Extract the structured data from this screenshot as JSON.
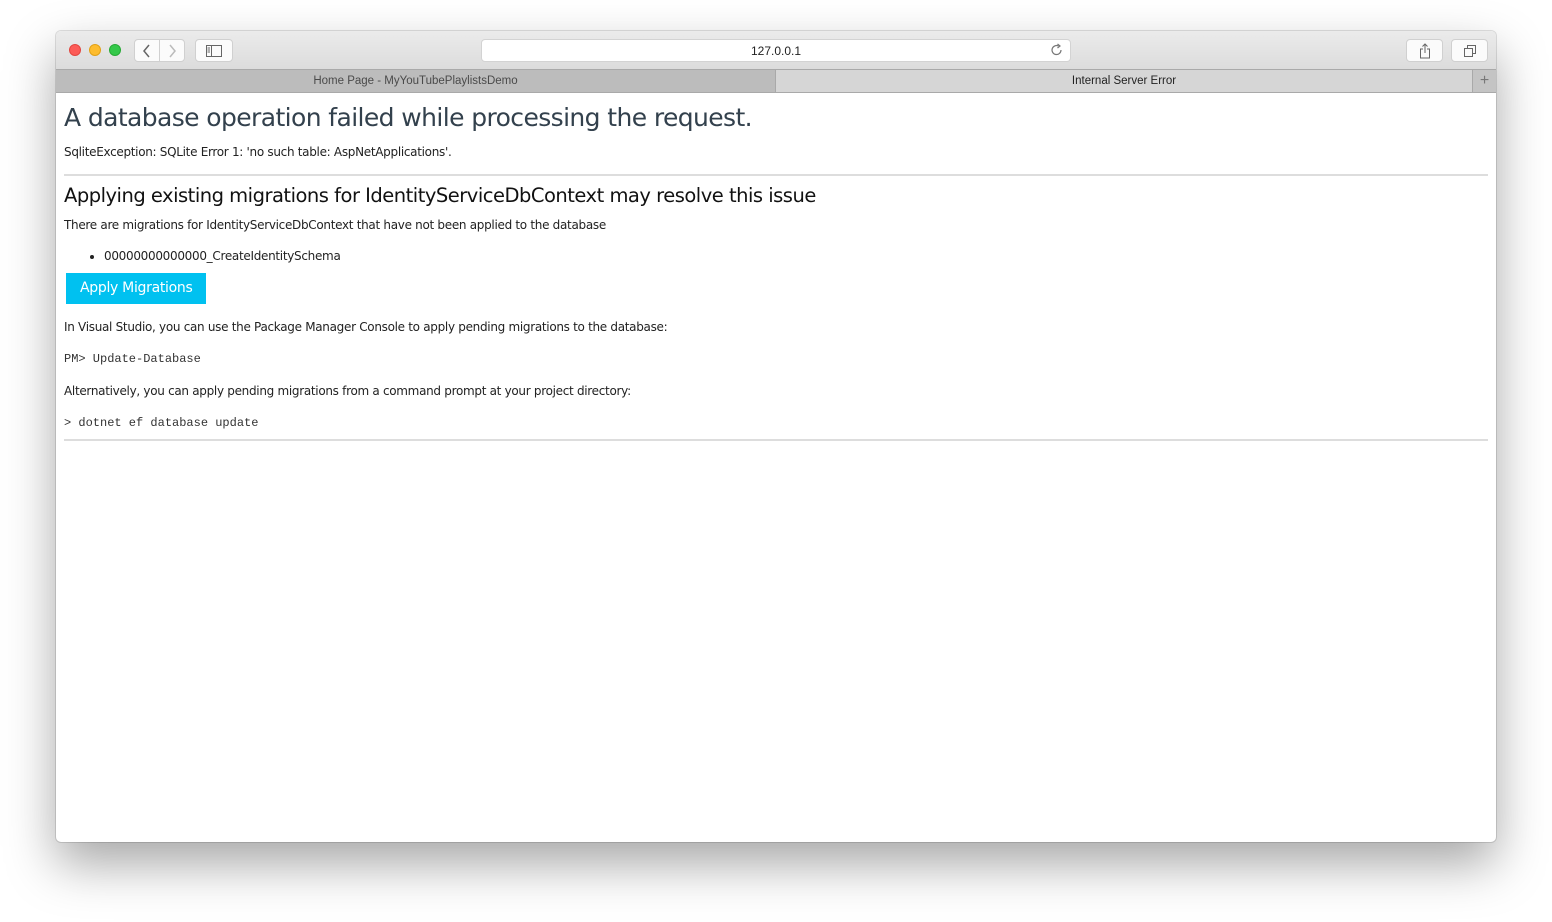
{
  "browser": {
    "url": "127.0.0.1",
    "tabs": [
      {
        "label": "Home Page - MyYouTubePlaylistsDemo",
        "active": false
      },
      {
        "label": "Internal Server Error",
        "active": true
      }
    ],
    "new_tab_label": "+",
    "icons": {
      "back": "chevron-left-icon",
      "forward": "chevron-right-icon",
      "sidebar": "sidebar-icon",
      "reload": "reload-icon",
      "share": "share-icon",
      "tabs_overview": "tabs-overview-icon"
    }
  },
  "page": {
    "title": "A database operation failed while processing the request.",
    "exception": "SqliteException: SQLite Error 1: 'no such table: AspNetApplications'.",
    "section_heading": "Applying existing migrations for IdentityServiceDbContext may resolve this issue",
    "pending_text": "There are migrations for IdentityServiceDbContext that have not been applied to the database",
    "migrations": [
      "00000000000000_CreateIdentitySchema"
    ],
    "apply_button_label": "Apply Migrations",
    "vs_text": "In Visual Studio, you can use the Package Manager Console to apply pending migrations to the database:",
    "pm_command": "PM> Update-Database",
    "cli_text": "Alternatively, you can apply pending migrations from a command prompt at your project directory:",
    "cli_command": "> dotnet ef database update"
  },
  "colors": {
    "button_bg": "#00c1f0",
    "title_color": "#33414d"
  }
}
